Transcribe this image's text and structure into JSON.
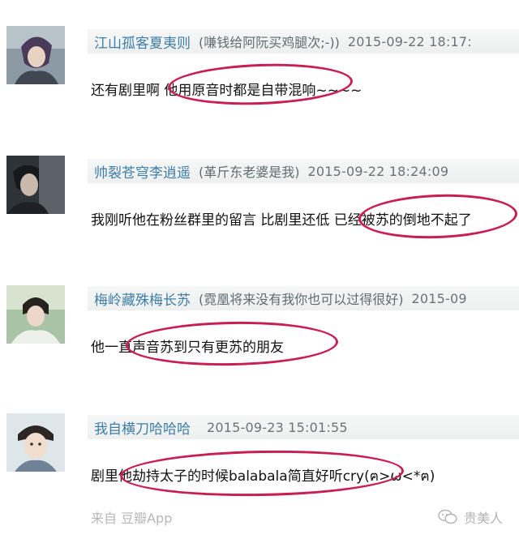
{
  "comments": [
    {
      "username": "江山孤客夏夷则",
      "signature": "(嗛钱给阿阮买鸡腿次;-))",
      "time": "2015-09-22 18:17:",
      "text": "还有剧里啊 他用原音时都是自带混响~~~~"
    },
    {
      "username": "帅裂苍穹李逍遥",
      "signature": "(革斤东老婆是我)",
      "time": "2015-09-22 18:24:09",
      "text": "我刚听他在粉丝群里的留言 比剧里还低 已经被苏的倒地不起了"
    },
    {
      "username": "梅岭藏殊梅长苏",
      "signature": "(霓凰将来没有我你也可以过得很好)",
      "time": "2015-09",
      "text": "他一直声音苏到只有更苏的朋友"
    },
    {
      "username": "我自横刀哈哈哈",
      "signature": "",
      "time": "2015-09-23 15:01:55",
      "text": "剧里他劫持太子的时候balabala简直好听cry(ฅ>ω<*ฅ)"
    }
  ],
  "footer": {
    "source": "来自 豆瓣App",
    "watermark": "贵美人"
  },
  "colors": {
    "highlight_circle": "#c81e53",
    "username": "#3d7ea6"
  }
}
